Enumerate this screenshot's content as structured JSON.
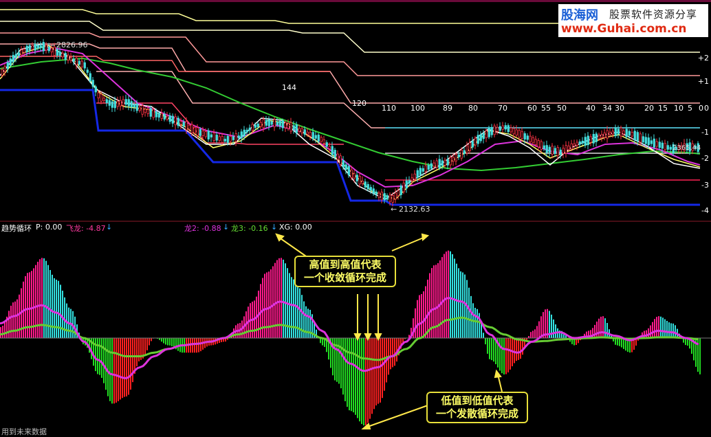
{
  "logo": {
    "brand": "股海网",
    "tagline": "股票软件资源分享",
    "url": "www.Guhai.com.cn"
  },
  "price_panel": {
    "high_label": "2826.96",
    "low_label": "2132.63",
    "last_label": "2365.44",
    "cycle_labels": [
      "144",
      "120",
      "110",
      "100",
      "89",
      "80",
      "70",
      "60",
      "55",
      "50",
      "40",
      "34",
      "30",
      "20",
      "15",
      "10",
      "5",
      "0"
    ],
    "level_labels": [
      "+2",
      "+1",
      "0",
      "-1",
      "-2",
      "-3",
      "-4"
    ]
  },
  "indicator_bar": {
    "name": "趋势循环",
    "p": "P: 0.00",
    "feilong": "飞龙: -4.87",
    "long2": "龙2: -0.88",
    "long3": "龙3: -0.16",
    "xg": "XG: 0.00",
    "down_arrow": "↓"
  },
  "callouts": {
    "top_line1": "高值到高值代表",
    "top_line2": "一个收敛循环完成",
    "bottom_line1": "低值到低值代表",
    "bottom_line2": "一个发散循环完成"
  },
  "footer": "用到未来数据",
  "colors": {
    "background": "#000000",
    "pink": "#ff1a8c",
    "cyan": "#33e0e0",
    "green": "#22dd22",
    "red": "#ff2020",
    "magenta": "#dd33dd",
    "long3_green": "#66cc33",
    "callout_text": "#ffff66",
    "floor_blue": "#1428e6"
  },
  "chart_data": [
    {
      "type": "line",
      "panel": "price",
      "title": "",
      "xlabel": "",
      "ylabel": "",
      "x": [
        0,
        20,
        40,
        60,
        80,
        100,
        120,
        140,
        160,
        180,
        200,
        220,
        240,
        260,
        280,
        300,
        320,
        340,
        360,
        380,
        400,
        420,
        440,
        460,
        480,
        500,
        520,
        540,
        560,
        580,
        600,
        620,
        640,
        660,
        680,
        700,
        720,
        740,
        760,
        780,
        800,
        820,
        840,
        860,
        880,
        900,
        920,
        940,
        960,
        980,
        1000
      ],
      "series": [
        {
          "values": [
            2700,
            2780,
            2820,
            2826.96,
            2800,
            2770,
            2740,
            2600,
            2560,
            2575,
            2540,
            2520,
            2500,
            2475,
            2440,
            2420,
            2400,
            2415,
            2460,
            2480,
            2475,
            2455,
            2430,
            2400,
            2330,
            2250,
            2200,
            2150,
            2132.63,
            2200,
            2260,
            2290,
            2300,
            2340,
            2400,
            2440,
            2460,
            2430,
            2400,
            2360,
            2345,
            2380,
            2400,
            2420,
            2440,
            2430,
            2400,
            2380,
            2360,
            2370,
            2365.44
          ]
        }
      ]
    },
    {
      "type": "bar",
      "panel": "indicator",
      "title": "",
      "ylim": [
        -13,
        13
      ],
      "x": [
        0,
        20,
        40,
        60,
        80,
        100,
        120,
        140,
        160,
        180,
        200,
        220,
        240,
        260,
        280,
        300,
        320,
        340,
        360,
        380,
        400,
        420,
        440,
        460,
        480,
        500,
        520,
        540,
        560,
        580,
        600,
        620,
        640,
        660,
        680,
        700,
        720,
        740,
        760,
        780,
        800,
        820,
        840,
        860,
        880,
        900,
        920,
        940,
        960,
        980,
        1000
      ],
      "series": [
        {
          "values": [
            1.5,
            5,
            9,
            11,
            8,
            4,
            -1,
            -5,
            -9,
            -8,
            -3,
            0,
            -1,
            -2,
            -2,
            -1,
            -0.5,
            2,
            5,
            9,
            11,
            8,
            4,
            -1,
            -6,
            -10,
            -12,
            -9,
            -4,
            0,
            6,
            10,
            12,
            9,
            4,
            -3,
            -5,
            -3,
            1,
            4,
            1,
            -1,
            1,
            3,
            -1,
            -2,
            1,
            3,
            2,
            -1,
            -5
          ]
        },
        {
          "name": "龙2",
          "values": [
            2,
            3,
            4,
            4.5,
            3.5,
            2,
            -0.5,
            -3,
            -5,
            -5.5,
            -4,
            -2.5,
            -1.5,
            -1,
            -0.8,
            -0.5,
            0,
            1,
            2.5,
            4,
            5,
            4.5,
            3,
            1,
            -1.5,
            -3.5,
            -4.5,
            -4,
            -2.5,
            -0.5,
            2,
            4,
            5.5,
            5,
            3,
            0.5,
            -1.5,
            -2,
            -0.5,
            0.5,
            0.8,
            0,
            0.2,
            0.8,
            0.3,
            -0.3,
            0.3,
            1,
            0.8,
            0,
            -0.88
          ]
        },
        {
          "name": "龙3",
          "values": [
            0.5,
            1,
            1.5,
            1.8,
            1.5,
            1,
            0,
            -1,
            -2,
            -2.5,
            -2.5,
            -2,
            -1.5,
            -1,
            -0.8,
            -0.5,
            0,
            0.5,
            1,
            1.5,
            1.8,
            1.5,
            0.8,
            0,
            -1,
            -2,
            -2.8,
            -3,
            -2.5,
            -1.5,
            0,
            1.5,
            2.5,
            2.8,
            2.3,
            1.5,
            0.5,
            -0.2,
            -0.5,
            -0.4,
            -0.2,
            -0.1,
            0,
            0.1,
            0,
            -0.1,
            0,
            0.1,
            0.1,
            0,
            -0.16
          ]
        }
      ]
    }
  ]
}
